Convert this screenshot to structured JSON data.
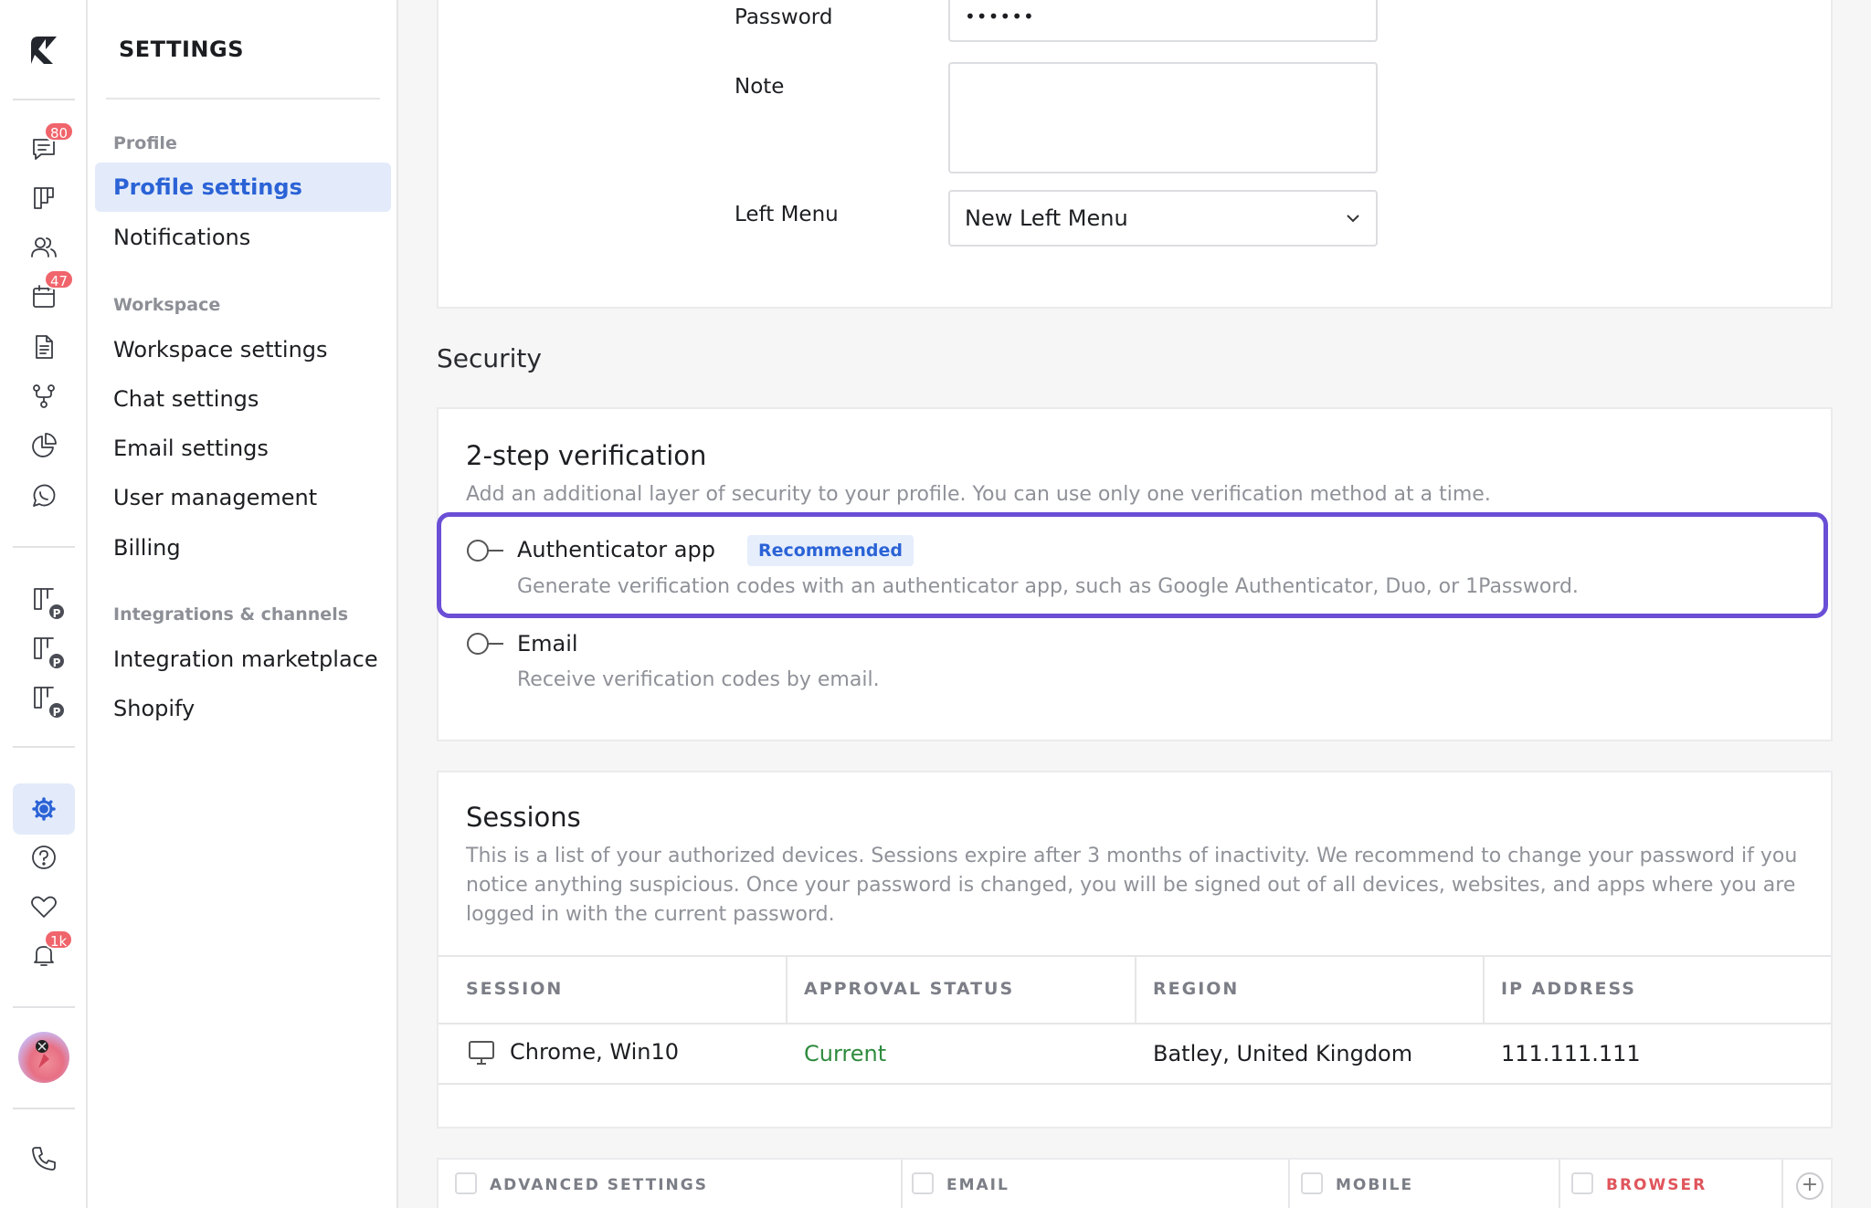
{
  "settings_title": "SETTINGS",
  "nav": {
    "profile_group": "Profile",
    "profile_settings": "Profile settings",
    "notifications": "Notifications",
    "workspace_group": "Workspace",
    "workspace_settings": "Workspace settings",
    "chat_settings": "Chat settings",
    "email_settings": "Email settings",
    "user_management": "User management",
    "billing": "Billing",
    "integrations_group": "Integrations & channels",
    "integration_marketplace": "Integration marketplace",
    "shopify": "Shopify"
  },
  "rail": {
    "chat_badge": "80",
    "calendar_badge": "47",
    "notifications_badge": "1k",
    "pipeline_badge_letter": "P"
  },
  "profile_form": {
    "password_label": "Password",
    "password_value": "••••••",
    "note_label": "Note",
    "note_value": "",
    "left_menu_label": "Left Menu",
    "left_menu_value": "New Left Menu"
  },
  "security": {
    "section_title": "Security",
    "two_step_title": "2-step verification",
    "two_step_desc": "Add an additional layer of security to your profile. You can use only one verification method at a time.",
    "auth_app_title": "Authenticator app",
    "recommended": "Recommended",
    "auth_app_desc": "Generate verification codes with an authenticator app, such as Google Authenticator, Duo, or 1Password.",
    "email_title": "Email",
    "email_desc": "Receive verification codes by email."
  },
  "sessions": {
    "title": "Sessions",
    "desc_line1": "This is a list of your authorized devices. Sessions expire after 3 months of inactivity. We recommend to change your password if you",
    "desc_line2": "notice anything suspicious. Once your password is changed, you will be signed out of all devices, websites, and apps where you are",
    "desc_line3": "logged in with the current password.",
    "columns": [
      "SESSION",
      "APPROVAL STATUS",
      "REGION",
      "IP ADDRESS"
    ],
    "row": {
      "session": "Chrome, Win10",
      "status": "Current",
      "region": "Batley, United Kingdom",
      "ip": "111.111.111"
    }
  },
  "notification_table": {
    "columns": [
      "ADVANCED SETTINGS",
      "EMAIL",
      "MOBILE",
      "BROWSER"
    ]
  },
  "colors": {
    "accent": "#2b63d6",
    "highlight": "#6a4fd6",
    "badge": "#f0646b",
    "current_status": "#2e8b3e",
    "browser_label": "#e0555c"
  }
}
